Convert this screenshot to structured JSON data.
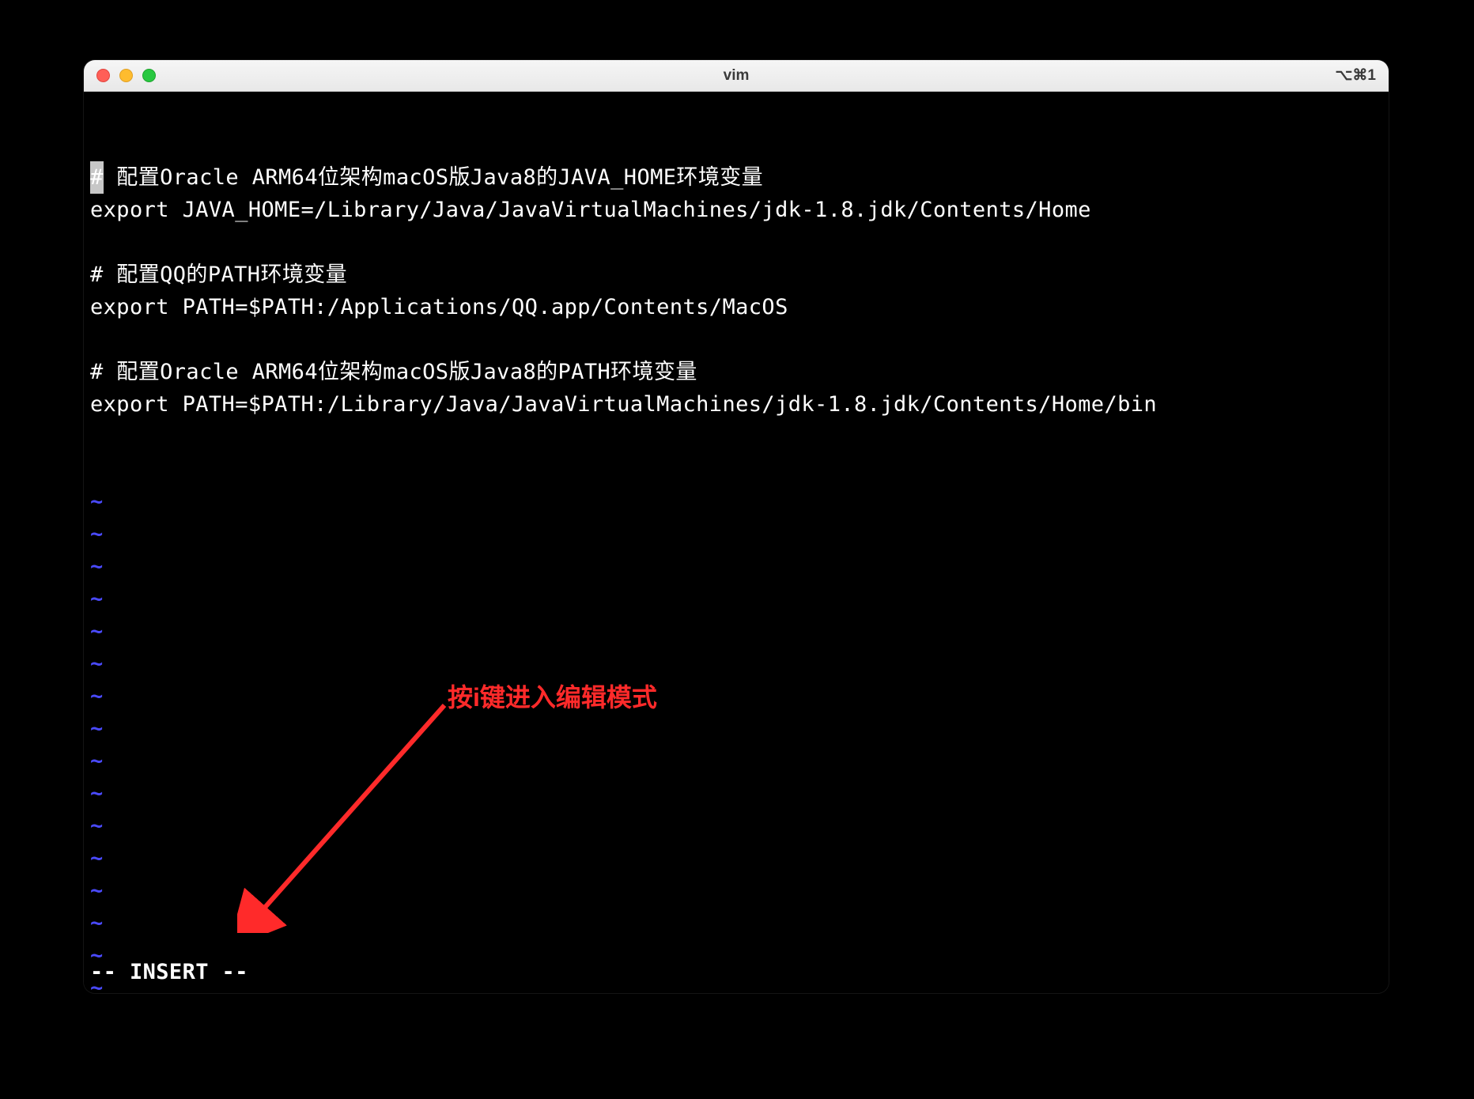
{
  "window": {
    "title": "vim",
    "shortcut_indicator": "⌥⌘1"
  },
  "editor": {
    "lines": [
      "# 配置Oracle ARM64位架构macOS版Java8的JAVA_HOME环境变量",
      "export JAVA_HOME=/Library/Java/JavaVirtualMachines/jdk-1.8.jdk/Contents/Home",
      "",
      "# 配置QQ的PATH环境变量",
      "export PATH=$PATH:/Applications/QQ.app/Contents/MacOS",
      "",
      "# 配置Oracle ARM64位架构macOS版Java8的PATH环境变量",
      "export PATH=$PATH:/Library/Java/JavaVirtualMachines/jdk-1.8.jdk/Contents/Home/bin"
    ],
    "tilde_count": 16,
    "tilde_char": "~",
    "statusline": "-- INSERT --"
  },
  "annotation": {
    "text": "按i键进入编辑模式"
  }
}
